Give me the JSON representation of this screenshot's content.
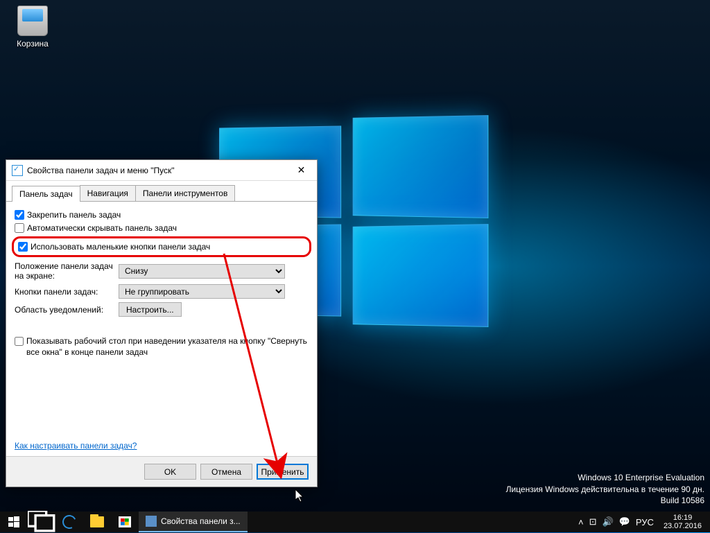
{
  "desktop": {
    "recycle_bin_label": "Корзина"
  },
  "watermark": {
    "line1": "Windows 10 Enterprise Evaluation",
    "line2": "Лицензия Windows действительна в течение 90 дн.",
    "line3": "Build 10586"
  },
  "dialog": {
    "title": "Свойства панели задач и меню \"Пуск\"",
    "tabs": {
      "taskbar": "Панель задач",
      "navigation": "Навигация",
      "toolbars": "Панели инструментов"
    },
    "options": {
      "lock_taskbar": "Закрепить панель задач",
      "auto_hide": "Автоматически скрывать панель задач",
      "small_buttons": "Использовать маленькие кнопки панели задач",
      "position_label": "Положение панели задач на экране:",
      "position_value": "Снизу",
      "buttons_label": "Кнопки панели задач:",
      "buttons_value": "Не группировать",
      "notification_label": "Область уведомлений:",
      "notification_button": "Настроить...",
      "peek_label": "Показывать рабочий стол при наведении указателя на кнопку \"Свернуть все окна\" в конце панели задач"
    },
    "help_link": "Как настраивать панели задач?",
    "buttons": {
      "ok": "OK",
      "cancel": "Отмена",
      "apply": "Применить"
    }
  },
  "taskbar": {
    "running_app": "Свойства панели з...",
    "lang": "РУС",
    "time": "16:19",
    "date": "23.07.2016"
  }
}
